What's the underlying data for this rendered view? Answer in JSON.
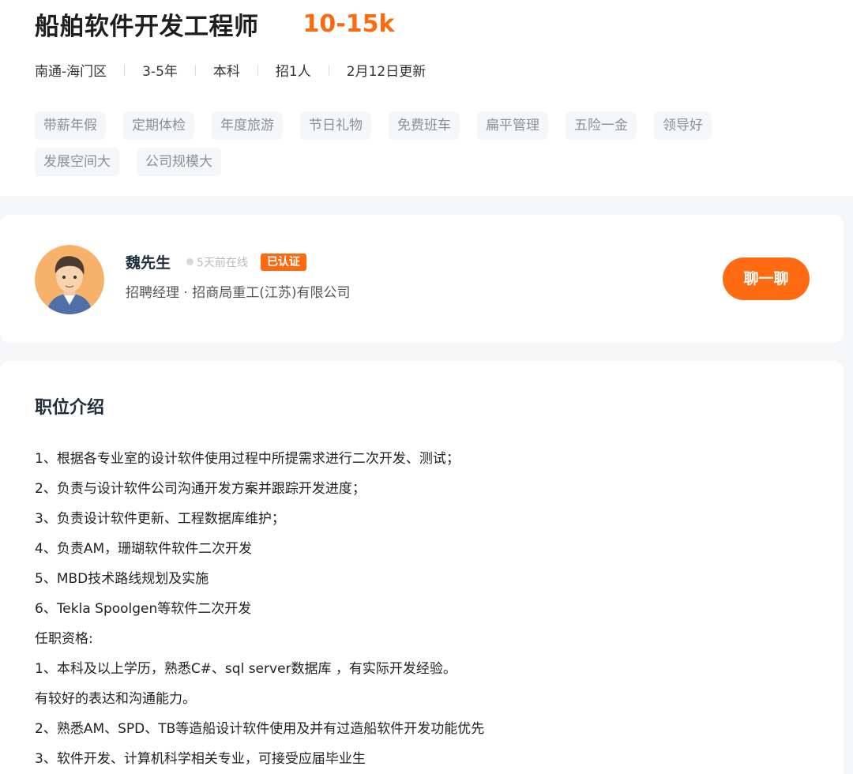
{
  "job": {
    "title": "船舶软件开发工程师",
    "salary": "10-15k",
    "meta": [
      "南通-海门区",
      "3-5年",
      "本科",
      "招1人",
      "2月12日更新"
    ],
    "tags": [
      "带薪年假",
      "定期体检",
      "年度旅游",
      "节日礼物",
      "免费班车",
      "扁平管理",
      "五险一金",
      "领导好",
      "发展空间大",
      "公司规模大"
    ]
  },
  "recruiter": {
    "name": "魏先生",
    "online": "5天前在线",
    "badge": "已认证",
    "title": "招聘经理 · 招商局重工(江苏)有限公司",
    "chat_label": "聊一聊"
  },
  "description": {
    "heading": "职位介绍",
    "lines": [
      "1、根据各专业室的设计软件使用过程中所提需求进行二次开发、测试；",
      "2、负责与设计软件公司沟通开发方案并跟踪开发进度；",
      "3、负责设计软件更新、工程数据库维护；",
      "4、负责AM，珊瑚软件软件二次开发",
      "5、MBD技术路线规划及实施",
      "6、Tekla Spoolgen等软件二次开发",
      "任职资格:",
      "1、本科及以上学历，熟悉C#、sql server数据库 ，有实际开发经验。",
      "有较好的表达和沟通能力。",
      "2、熟悉AM、SPD、TB等造船设计软件使用及并有过造船软件开发功能优先",
      "3、软件开发、计算机科学相关专业，可接受应届毕业生"
    ]
  },
  "colors": {
    "accent": "#fe6a10"
  }
}
